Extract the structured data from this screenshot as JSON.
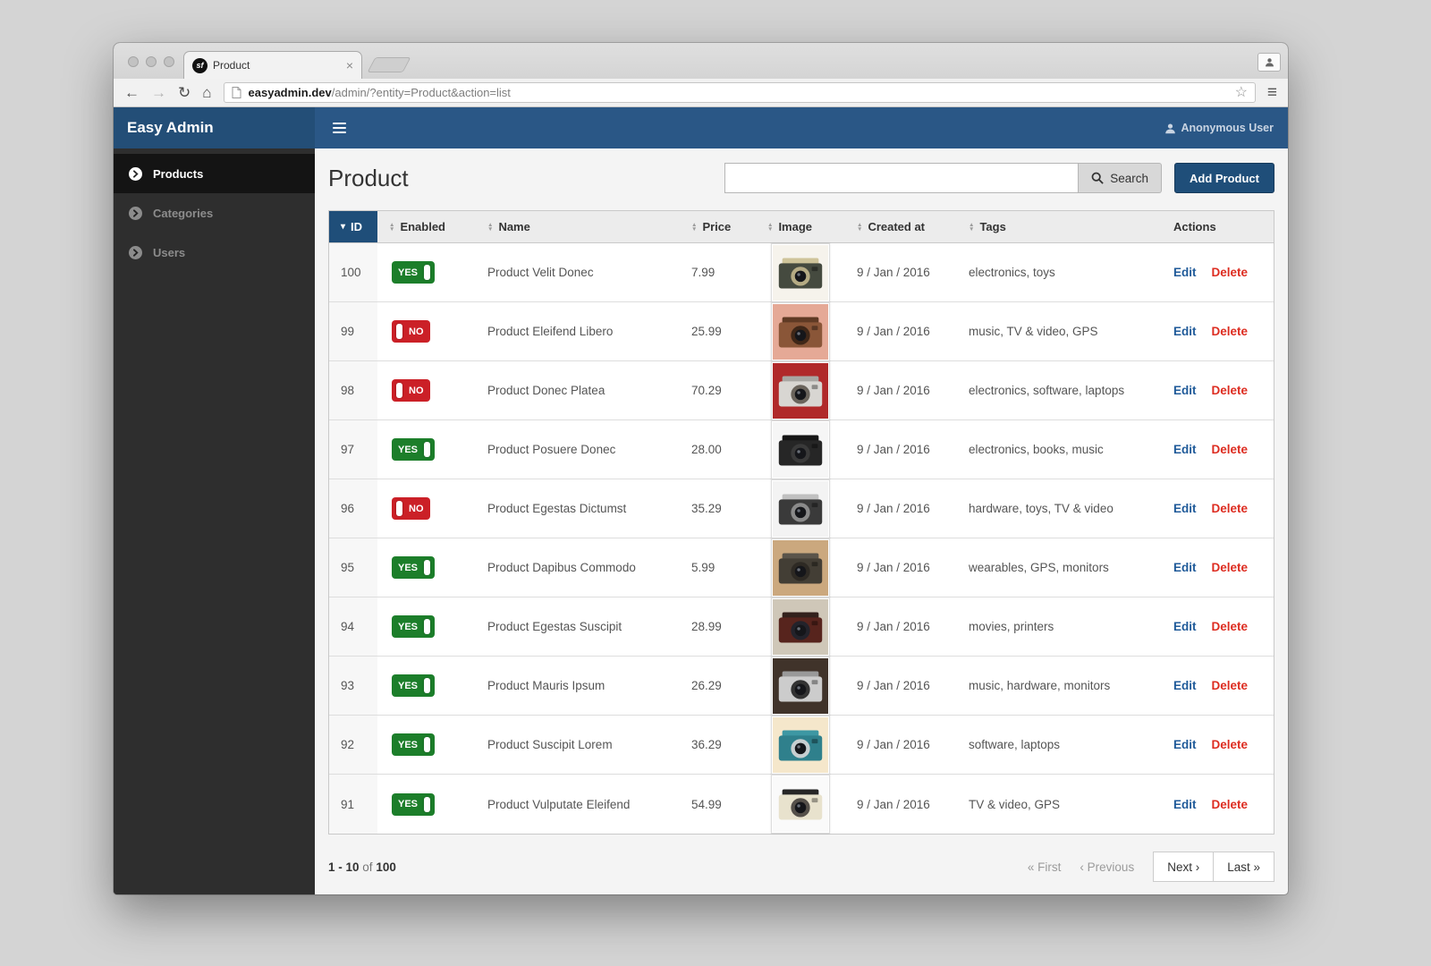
{
  "browser": {
    "tab_title": "Product",
    "logo_text": "sf",
    "url_host": "easyadmin.dev",
    "url_path": "/admin/?entity=Product&action=list"
  },
  "icons": {
    "back": "←",
    "forward": "→",
    "reload": "↻",
    "home": "⌂",
    "star": "☆",
    "menu": "≡",
    "close": "×",
    "sort_desc": "▾",
    "sort_up": "▲",
    "sort_down": "▼"
  },
  "colors": {
    "brand_blue_dark": "#234e77",
    "header_blue": "#2a5786",
    "button_blue": "#1f4e79",
    "badge_green": "#1c7e2a",
    "badge_red": "#cb2027",
    "edit_blue": "#1f5a99",
    "delete_red": "#dd2c20"
  },
  "header": {
    "brand": "Easy Admin",
    "user": "Anonymous User"
  },
  "sidebar": {
    "items": [
      {
        "label": "Products",
        "active": true
      },
      {
        "label": "Categories",
        "active": false
      },
      {
        "label": "Users",
        "active": false
      }
    ]
  },
  "main": {
    "title": "Product",
    "search_value": "",
    "search_button": "Search",
    "add_button": "Add Product"
  },
  "table": {
    "yes_label": "YES",
    "no_label": "NO",
    "edit_label": "Edit",
    "delete_label": "Delete",
    "columns": [
      {
        "label": "ID",
        "sort": "desc"
      },
      {
        "label": "Enabled",
        "sort": "both"
      },
      {
        "label": "Name",
        "sort": "both"
      },
      {
        "label": "Price",
        "sort": "both"
      },
      {
        "label": "Image",
        "sort": "both"
      },
      {
        "label": "Created at",
        "sort": "both"
      },
      {
        "label": "Tags",
        "sort": "both"
      },
      {
        "label": "Actions",
        "sort": null
      }
    ],
    "rows": [
      {
        "id": "100",
        "enabled": true,
        "name": "Product Velit Donec",
        "price": "7.99",
        "created": "9 / Jan / 2016",
        "tags": "electronics, toys",
        "image": {
          "bg": "#f6f3ec",
          "top": "#cfc49a",
          "body": "#454a3f",
          "ring": "#b5ab84"
        }
      },
      {
        "id": "99",
        "enabled": false,
        "name": "Product Eleifend Libero",
        "price": "25.99",
        "created": "9 / Jan / 2016",
        "tags": "music, TV & video, GPS",
        "image": {
          "bg": "#e5a996",
          "top": "#5f3a24",
          "body": "#8a5638",
          "ring": "#3f2718"
        }
      },
      {
        "id": "98",
        "enabled": false,
        "name": "Product Donec Platea",
        "price": "70.29",
        "created": "9 / Jan / 2016",
        "tags": "electronics, software, laptops",
        "image": {
          "bg": "#b0292a",
          "top": "#a8a6a2",
          "body": "#d8d6d2",
          "ring": "#6a645c"
        }
      },
      {
        "id": "97",
        "enabled": true,
        "name": "Product Posuere Donec",
        "price": "28.00",
        "created": "9 / Jan / 2016",
        "tags": "electronics, books, music",
        "image": {
          "bg": "#f6f6f6",
          "top": "#161616",
          "body": "#262626",
          "ring": "#3a3a3a"
        }
      },
      {
        "id": "96",
        "enabled": false,
        "name": "Product Egestas Dictumst",
        "price": "35.29",
        "created": "9 / Jan / 2016",
        "tags": "hardware, toys, TV & video",
        "image": {
          "bg": "#f3f3f3",
          "top": "#c0c0c0",
          "body": "#3a3a3a",
          "ring": "#8a8a8a"
        }
      },
      {
        "id": "95",
        "enabled": true,
        "name": "Product Dapibus Commodo",
        "price": "5.99",
        "created": "9 / Jan / 2016",
        "tags": "wearables, GPS, monitors",
        "image": {
          "bg": "#cba87e",
          "top": "#5a544a",
          "body": "#433e35",
          "ring": "#2e2a24"
        }
      },
      {
        "id": "94",
        "enabled": true,
        "name": "Product Egestas Suscipit",
        "price": "28.99",
        "created": "9 / Jan / 2016",
        "tags": "movies, printers",
        "image": {
          "bg": "#cfc7b8",
          "top": "#33211c",
          "body": "#57241d",
          "ring": "#23232b"
        }
      },
      {
        "id": "93",
        "enabled": true,
        "name": "Product Mauris Ipsum",
        "price": "26.29",
        "created": "9 / Jan / 2016",
        "tags": "music, hardware, monitors",
        "image": {
          "bg": "#40332a",
          "top": "#999999",
          "body": "#cccccc",
          "ring": "#333333"
        }
      },
      {
        "id": "92",
        "enabled": true,
        "name": "Product Suscipit Lorem",
        "price": "36.29",
        "created": "9 / Jan / 2016",
        "tags": "software, laptops",
        "image": {
          "bg": "#f5e7cb",
          "top": "#3d97a3",
          "body": "#2f808c",
          "ring": "#c7ced0"
        }
      },
      {
        "id": "91",
        "enabled": true,
        "name": "Product Vulputate Eleifend",
        "price": "54.99",
        "created": "9 / Jan / 2016",
        "tags": "TV & video, GPS",
        "image": {
          "bg": "#fafafa",
          "top": "#262626",
          "body": "#e8e2cd",
          "ring": "#55504a"
        }
      }
    ]
  },
  "pagination": {
    "range": "1 - 10",
    "of_label": "of",
    "total": "100",
    "first": "« First",
    "previous": "‹ Previous",
    "next": "Next ›",
    "last": "Last »"
  }
}
